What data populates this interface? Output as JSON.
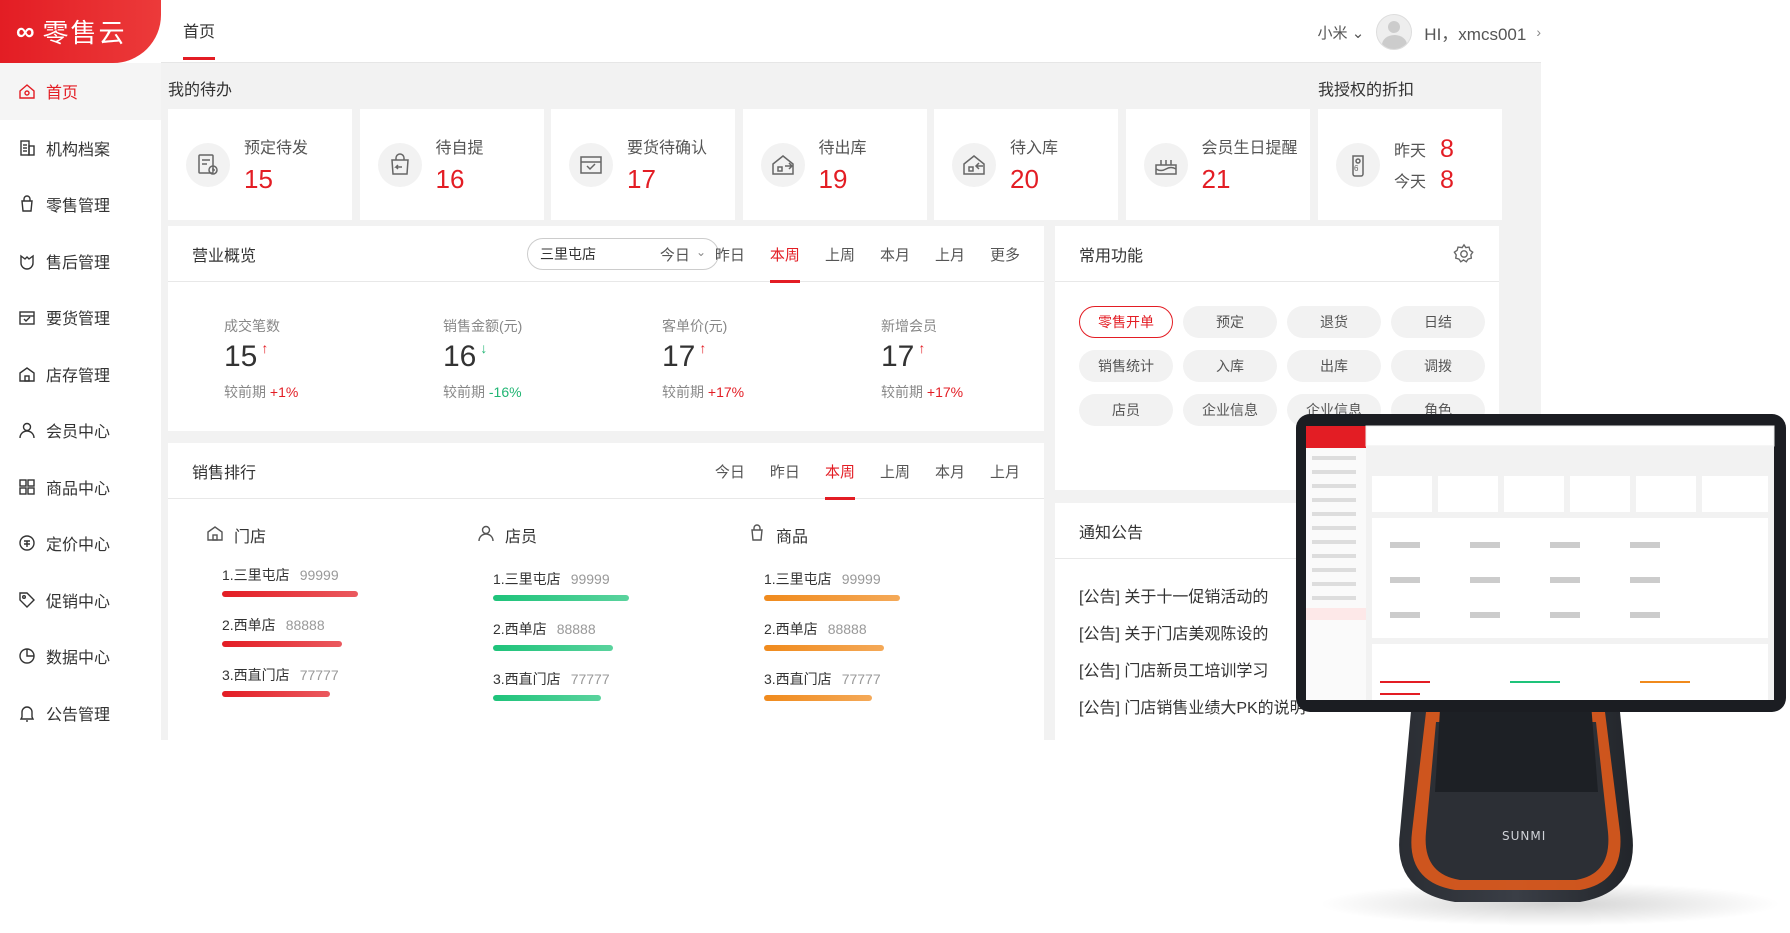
{
  "app": {
    "logo_text": "零售云",
    "brand_color": "#e31d24"
  },
  "sidebar": {
    "items": [
      {
        "label": "首页",
        "icon": "home-icon",
        "active": true
      },
      {
        "label": "机构档案",
        "icon": "building-icon"
      },
      {
        "label": "零售管理",
        "icon": "shopping-bag-icon"
      },
      {
        "label": "售后管理",
        "icon": "service-icon"
      },
      {
        "label": "要货管理",
        "icon": "box-icon"
      },
      {
        "label": "店存管理",
        "icon": "store-icon"
      },
      {
        "label": "会员中心",
        "icon": "user-icon"
      },
      {
        "label": "商品中心",
        "icon": "grid-icon"
      },
      {
        "label": "定价中心",
        "icon": "price-icon"
      },
      {
        "label": "促销中心",
        "icon": "tag-icon"
      },
      {
        "label": "数据中心",
        "icon": "chart-icon"
      },
      {
        "label": "公告管理",
        "icon": "bell-icon"
      }
    ]
  },
  "topbar": {
    "tab": "首页",
    "store": "小米",
    "greeting": "HI，xmcs001"
  },
  "todo": {
    "title": "我的待办",
    "cards": [
      {
        "label": "预定待发",
        "value": "15",
        "icon": "reservation-icon"
      },
      {
        "label": "待自提",
        "value": "16",
        "icon": "pickup-bag-icon"
      },
      {
        "label": "要货待确认",
        "value": "17",
        "icon": "confirm-box-icon"
      },
      {
        "label": "待出库",
        "value": "19",
        "icon": "outbound-icon"
      },
      {
        "label": "待入库",
        "value": "20",
        "icon": "inbound-icon"
      },
      {
        "label": "会员生日提醒",
        "value": "21",
        "icon": "cake-icon"
      }
    ]
  },
  "discount": {
    "title": "我授权的折扣",
    "yesterday_label": "昨天",
    "yesterday_value": "8",
    "today_label": "今天",
    "today_value": "8"
  },
  "business": {
    "title": "营业概览",
    "store_select": "三里屯店",
    "periods": [
      "今日",
      "昨日",
      "本周",
      "上周",
      "本月",
      "上月",
      "更多"
    ],
    "active_period": "本周",
    "metrics": [
      {
        "label": "成交笔数",
        "value": "15",
        "trend": "up",
        "compare_label": "较前期",
        "compare": "+1%"
      },
      {
        "label": "销售金额(元)",
        "value": "16",
        "trend": "down",
        "compare_label": "较前期",
        "compare": "-16%"
      },
      {
        "label": "客单价(元)",
        "value": "17",
        "trend": "up",
        "compare_label": "较前期",
        "compare": "+17%"
      },
      {
        "label": "新增会员",
        "value": "17",
        "trend": "up",
        "compare_label": "较前期",
        "compare": "+17%"
      }
    ]
  },
  "ranking": {
    "title": "销售排行",
    "periods": [
      "今日",
      "昨日",
      "本周",
      "上周",
      "本月",
      "上月"
    ],
    "active_period": "本周",
    "columns": [
      {
        "title": "门店",
        "icon": "store-icon",
        "color": "#e31d24",
        "items": [
          {
            "name": "1.三里屯店",
            "value": "99999"
          },
          {
            "name": "2.西单店",
            "value": "88888"
          },
          {
            "name": "3.西直门店",
            "value": "77777"
          }
        ]
      },
      {
        "title": "店员",
        "icon": "user-icon",
        "color": "#1ec37a",
        "items": [
          {
            "name": "1.三里屯店",
            "value": "99999"
          },
          {
            "name": "2.西单店",
            "value": "88888"
          },
          {
            "name": "3.西直门店",
            "value": "77777"
          }
        ]
      },
      {
        "title": "商品",
        "icon": "bag-icon",
        "color": "#f08a1c",
        "items": [
          {
            "name": "1.三里屯店",
            "value": "99999"
          },
          {
            "name": "2.西单店",
            "value": "88888"
          },
          {
            "name": "3.西直门店",
            "value": "77777"
          }
        ]
      }
    ]
  },
  "functions": {
    "title": "常用功能",
    "chips": [
      "零售开单",
      "预定",
      "退货",
      "日结",
      "销售统计",
      "入库",
      "出库",
      "调拨",
      "店员",
      "企业信息",
      "企业信息",
      "角色"
    ]
  },
  "notices": {
    "title": "通知公告",
    "items": [
      "[公告] 关于十一促销活动的",
      "[公告] 关于门店美观陈设的",
      "[公告] 门店新员工培训学习",
      "[公告] 门店销售业绩大PK的说明"
    ]
  },
  "device": {
    "brand": "SUNMI"
  }
}
